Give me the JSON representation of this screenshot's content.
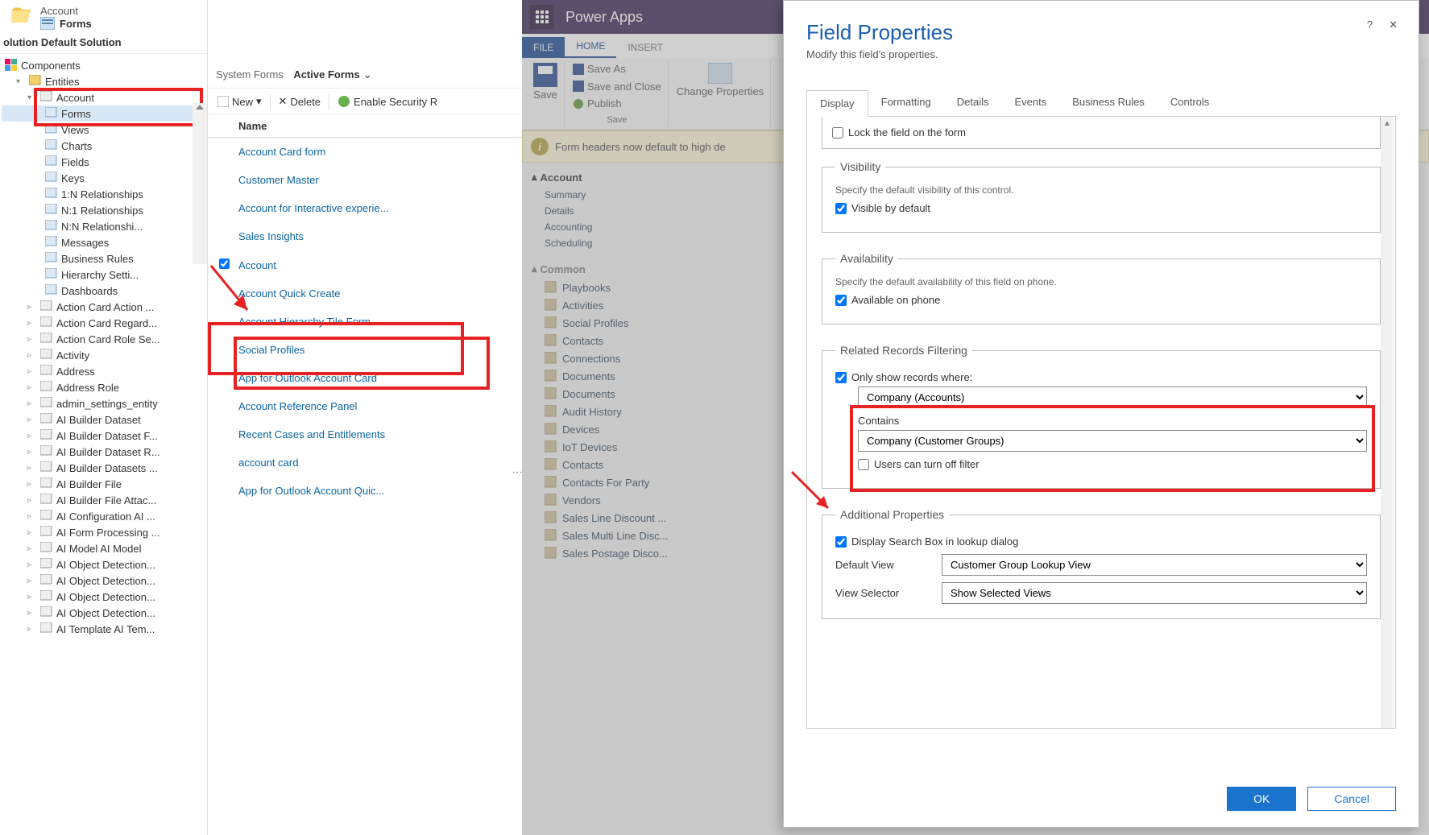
{
  "left": {
    "breadcrumb_small": "Account",
    "breadcrumb_big": "Forms",
    "solution_label": "olution Default Solution",
    "components_label": "Components",
    "tree": {
      "entities": "Entities",
      "account": "Account",
      "account_children": [
        "Forms",
        "Views",
        "Charts",
        "Fields",
        "Keys",
        "1:N Relationships",
        "N:1 Relationships",
        "N:N Relationshi...",
        "Messages",
        "Business Rules",
        "Hierarchy Setti...",
        "Dashboards"
      ],
      "others": [
        "Action Card Action ...",
        "Action Card Regard...",
        "Action Card Role Se...",
        "Activity",
        "Address",
        "Address Role",
        "admin_settings_entity",
        "AI Builder Dataset",
        "AI Builder Dataset F...",
        "AI Builder Dataset R...",
        "AI Builder Datasets ...",
        "AI Builder File",
        "AI Builder File Attac...",
        "AI Configuration AI ...",
        "AI Form Processing ...",
        "AI Model AI Model",
        "AI Object Detection...",
        "AI Object Detection...",
        "AI Object Detection...",
        "AI Object Detection...",
        "AI Template AI Tem..."
      ]
    }
  },
  "mid": {
    "sys_forms": "System Forms",
    "active_forms": "Active Forms",
    "toolbar": {
      "new": "New",
      "delete": "Delete",
      "enable_sec": "Enable Security R"
    },
    "col_name": "Name",
    "rows": [
      "Account Card form",
      "Customer Master",
      "Account for Interactive experie...",
      "Sales Insights",
      "Account",
      "Account Quick Create",
      "Account Hierarchy Tile Form",
      "Social Profiles",
      "App for Outlook Account Card",
      "Account Reference Panel",
      "Recent Cases and Entitlements",
      "account card",
      "App for Outlook Account Quic..."
    ]
  },
  "rback": {
    "app": "Power Apps",
    "tabs": {
      "file": "FILE",
      "home": "HOME",
      "insert": "INSERT"
    },
    "ribbon": {
      "save": "Save",
      "save_as": "Save As",
      "save_close": "Save and Close",
      "publish": "Publish",
      "save_grp": "Save",
      "change_props": "Change Properties"
    },
    "info": "Form headers now default to high de",
    "nav": {
      "account": "Account",
      "acct_items": [
        "Summary",
        "Details",
        "Accounting",
        "Scheduling"
      ],
      "common": "Common",
      "common_items": [
        "Playbooks",
        "Activities",
        "Social Profiles",
        "Contacts",
        "Connections",
        "Documents",
        "Documents",
        "Audit History",
        "Devices",
        "IoT Devices",
        "Contacts",
        "Contacts For Party",
        "Vendors",
        "Sales Line Discount ...",
        "Sales Multi Line Disc...",
        "Sales Postage Disco..."
      ]
    }
  },
  "modal": {
    "title": "Field Properties",
    "subtitle": "Modify this field's properties.",
    "tabs": [
      "Display",
      "Formatting",
      "Details",
      "Events",
      "Business Rules",
      "Controls"
    ],
    "lock_label": "Lock the field on the form",
    "vis": {
      "legend": "Visibility",
      "hint": "Specify the default visibility of this control.",
      "cb": "Visible by default"
    },
    "avail": {
      "legend": "Availability",
      "hint": "Specify the default availability of this field on phone.",
      "cb": "Available on phone"
    },
    "rel": {
      "legend": "Related Records Filtering",
      "cb": "Only show records where:",
      "dd1": "Company (Accounts)",
      "contains": "Contains",
      "dd2": "Company (Customer Groups)",
      "turnoff": "Users can turn off filter"
    },
    "add": {
      "legend": "Additional Properties",
      "searchbox": "Display Search Box in lookup dialog",
      "def_view_l": "Default View",
      "def_view_v": "Customer Group Lookup View",
      "vsel_l": "View Selector",
      "vsel_v": "Show Selected Views"
    },
    "ok": "OK",
    "cancel": "Cancel"
  }
}
